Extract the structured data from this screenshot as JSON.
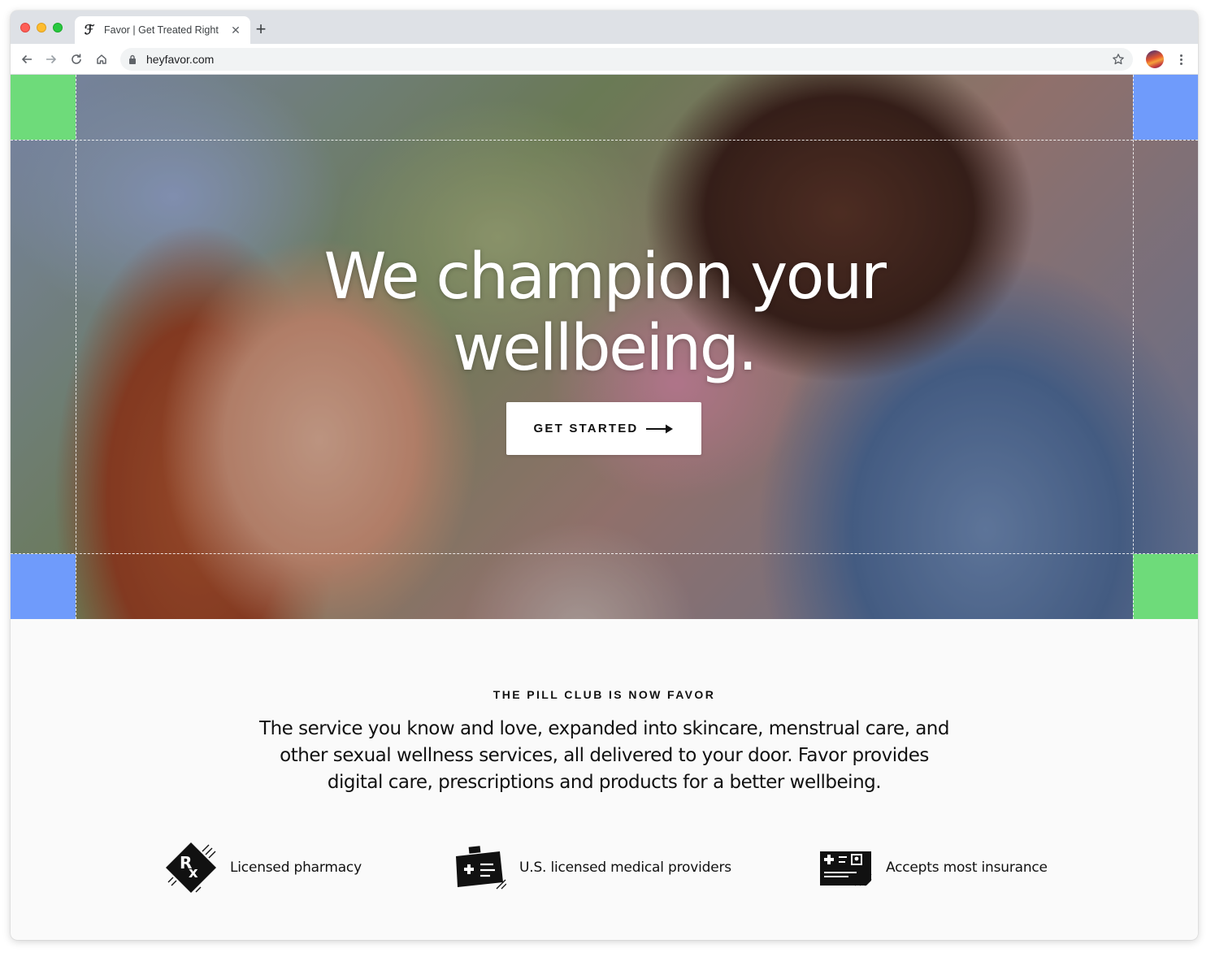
{
  "browser": {
    "tab_title": "Favor | Get Treated Right",
    "tab_favicon": "favor-logo-icon",
    "tab_close_glyph": "✕",
    "new_tab_glyph": "+",
    "url": "heyfavor.com"
  },
  "hero": {
    "title_line1": "We champion your",
    "title_line2": "wellbeing.",
    "cta_label": "GET STARTED",
    "accent_green": "#6edb7a",
    "accent_blue": "#6f9bfb"
  },
  "intro": {
    "eyebrow": "THE PILL CLUB IS NOW FAVOR",
    "body": "The service you know and love, expanded into skincare, menstrual care, and other sexual wellness services, all delivered to your door. Favor provides digital care, prescriptions and products for a better wellbeing."
  },
  "features": [
    {
      "icon": "rx-diamond-icon",
      "label": "Licensed pharmacy"
    },
    {
      "icon": "medical-kit-icon",
      "label": "U.S. licensed medical providers"
    },
    {
      "icon": "insurance-card-icon",
      "label": "Accepts most insurance"
    }
  ]
}
